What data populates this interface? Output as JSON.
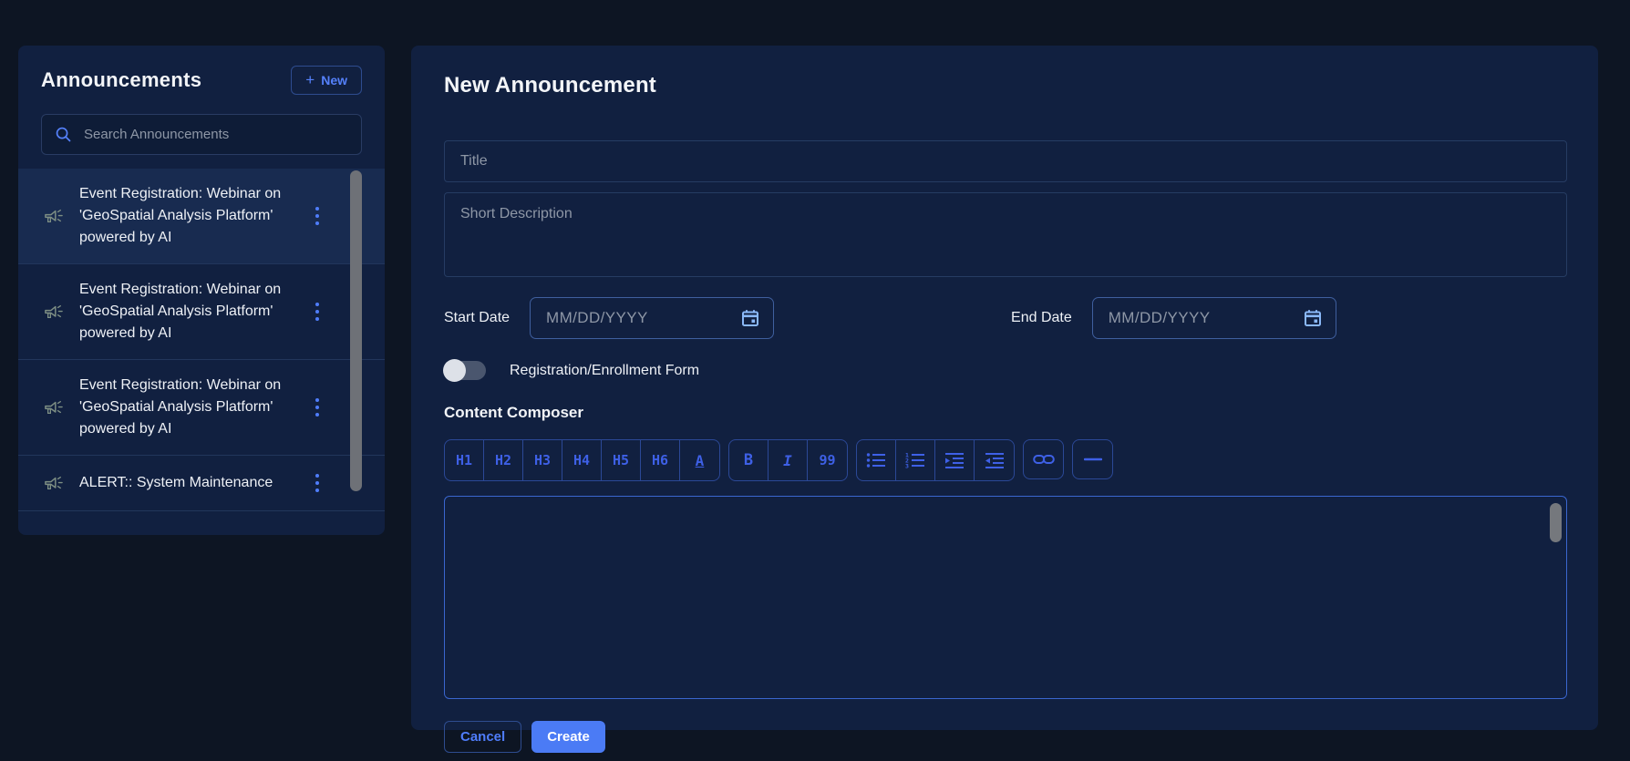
{
  "colors": {
    "page_bg": "#0d1523",
    "panel_bg": "#112040",
    "accent_blue": "#5581fb",
    "toolbar_blue": "#3e60e6",
    "create_button_bg": "#4b7bf5",
    "highlight_row": "#182b50",
    "calendar_icon": "#8ab8f8",
    "megaphone_icon": "#7e8f84"
  },
  "sidebar": {
    "title": "Announcements",
    "new_button": {
      "plus": "+",
      "label": "New"
    },
    "search_placeholder": "Search Announcements",
    "items": [
      {
        "text": "Event Registration: Webinar on 'GeoSpatial Analysis Platform' powered by AI",
        "highlighted": true
      },
      {
        "text": "Event Registration: Webinar on 'GeoSpatial Analysis Platform' powered by AI",
        "highlighted": false
      },
      {
        "text": "Event Registration: Webinar on 'GeoSpatial Analysis Platform' powered by AI",
        "highlighted": false
      },
      {
        "text": "ALERT:: System Maintenance",
        "highlighted": false
      }
    ]
  },
  "main": {
    "title": "New Announcement",
    "form": {
      "title_placeholder": "Title",
      "description_placeholder": "Short Description",
      "start_date_label": "Start Date",
      "end_date_label": "End Date",
      "date_placeholder": "MM/DD/YYYY",
      "toggle_label": "Registration/Enrollment Form",
      "toggle_state": "off"
    },
    "composer": {
      "heading": "Content Composer",
      "toolbar": {
        "headings": [
          "H1",
          "H2",
          "H3",
          "H4",
          "H5",
          "H6",
          "A"
        ],
        "format": [
          "B",
          "I",
          "99"
        ],
        "list_icons": [
          "bullet-list",
          "numbered-list",
          "indent",
          "outdent"
        ],
        "link_icon": "link",
        "rule_icon": "horizontal-rule"
      }
    },
    "actions": {
      "cancel": "Cancel",
      "create": "Create"
    }
  }
}
